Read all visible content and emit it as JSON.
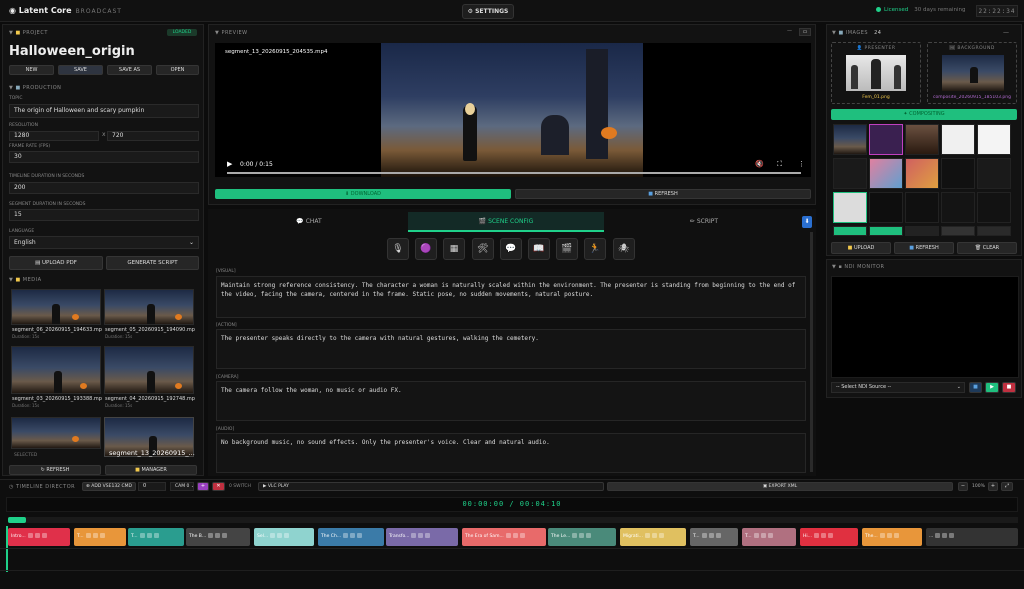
{
  "app": {
    "name": "Latent Core",
    "sub": "BROADCAST",
    "settings": "SETTINGS",
    "license": "Licensed",
    "remaining": "30 days remaining",
    "clock": "22:22:34"
  },
  "project": {
    "header": "PROJECT",
    "status": "LOADED",
    "title": "Halloween_origin",
    "buttons": [
      "NEW",
      "SAVE",
      "SAVE AS",
      "OPEN"
    ]
  },
  "production": {
    "header": "PRODUCTION",
    "topic_label": "TOPIC",
    "topic": "The origin of Halloween and scary pumpkin",
    "res_label": "RESOLUTION",
    "res_w": "1280",
    "res_x": "x",
    "res_h": "720",
    "fps_label": "FRAME RATE (FPS)",
    "fps": "30",
    "timeline_label": "TIMELINE DURATION IN SECONDS",
    "timeline": "200",
    "segment_label": "SEGMENT DURATION IN SECONDS",
    "segment": "15",
    "lang_label": "LANGUAGE",
    "lang": "English",
    "upload_pdf": "UPLOAD PDF",
    "generate": "GENERATE SCRIPT"
  },
  "media": {
    "header": "MEDIA",
    "items": [
      {
        "name": "segment_06_20260915_194633.mp4",
        "dur": "Duration: 15s"
      },
      {
        "name": "segment_05_20260915_194090.mp4",
        "dur": "Duration: 15s"
      },
      {
        "name": "segment_03_20260915_193388.mp4",
        "dur": "Duration: 15s"
      },
      {
        "name": "segment_04_20260915_192748.mp4",
        "dur": "Duration: 15s"
      },
      {
        "name": "SELECTED",
        "dur": ""
      },
      {
        "name": "segment_13_20260915_...",
        "dur": ""
      }
    ],
    "refresh": "REFRESH",
    "manager": "MANAGER"
  },
  "preview": {
    "header": "PREVIEW",
    "filename": "segment_13_20260915_204535.mp4",
    "time": "0:00 / 0:15",
    "download": "DOWNLOAD",
    "refresh": "REFRESH"
  },
  "tabs": [
    "CHAT",
    "SCENE CONFIG",
    "SCRIPT"
  ],
  "scene": {
    "visual_tag": "[VISUAL]",
    "visual": "Maintain strong reference consistency. The character a woman is naturally scaled within the environment. The presenter is standing from beginning to the end of the video, facing the camera, centered in the frame. Static pose, no sudden movements, natural posture.",
    "action_tag": "[ACTION]",
    "action": "The presenter speaks directly to the camera with natural gestures, walking the cemetery.",
    "camera_tag": "[CAMERA]",
    "camera": "The camera follow the woman,  no music or audio FX.",
    "audio_tag": "[AUDIO]",
    "audio": "No background music, no sound effects. Only the presenter's voice. Clear and natural audio."
  },
  "images": {
    "header": "IMAGES",
    "count": "24",
    "presenter": "PRESENTER",
    "presenter_file": "Fem_01.png",
    "background": "BACKGROUND",
    "background_file": "composite_20260915_185103.png",
    "compositing": "COMPOSITING",
    "upload": "UPLOAD",
    "refresh": "REFRESH",
    "clear": "CLEAR"
  },
  "ndi": {
    "header": "NDI MONITOR",
    "source": "-- Select NDI Source --"
  },
  "timeline": {
    "header": "TIMELINE DIRECTOR",
    "add": "ADD VSE132 CMD",
    "add_val": "0",
    "cam": "CAM 0",
    "switch": "0 SWITCH",
    "vlc": "VLC PLAY",
    "export": "EXPORT XML",
    "zoom": "100%",
    "time": "00:00:00 / 00:04:10",
    "clips": [
      {
        "label": "Intro...",
        "color": "#e0304a"
      },
      {
        "label": "T...",
        "color": "#e8963a"
      },
      {
        "label": "T...",
        "color": "#2a9d8f"
      },
      {
        "label": "The B...",
        "color": "#444"
      },
      {
        "label": "Sel...",
        "color": "#8fd3cf"
      },
      {
        "label": "The Ch...",
        "color": "#3b7ba8"
      },
      {
        "label": "Transfo...",
        "color": "#7a6aa8"
      },
      {
        "label": "The Era of Sam...",
        "color": "#e86a6a"
      },
      {
        "label": "The Le...",
        "color": "#4a8a7a"
      },
      {
        "label": "Migrati...",
        "color": "#e0c060"
      },
      {
        "label": "T...",
        "color": "#666"
      },
      {
        "label": "T...",
        "color": "#b07080"
      },
      {
        "label": "Hi...",
        "color": "#e03040"
      },
      {
        "label": "The...",
        "color": "#e8963a"
      },
      {
        "label": "...",
        "color": "#333"
      }
    ]
  }
}
